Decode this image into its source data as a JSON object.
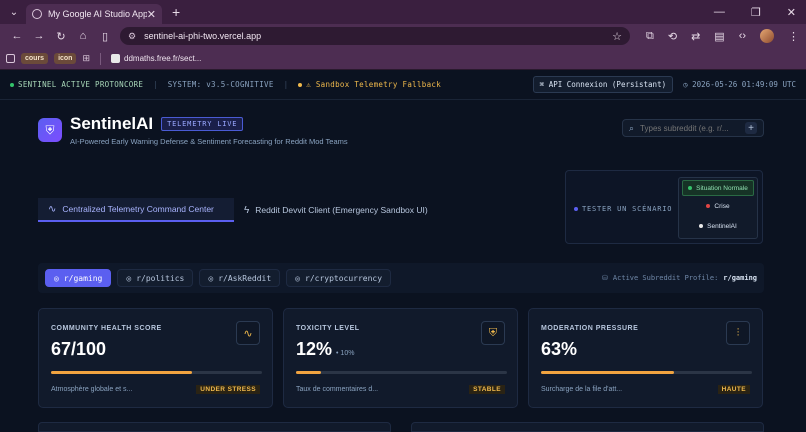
{
  "browser": {
    "tab_title": "My Google AI Studio App",
    "url": "sentinel-ai-phi-two.vercel.app",
    "bookmarks": [
      "cours",
      "icon"
    ],
    "bookmark_link": "ddmaths.free.fr/sect..."
  },
  "statusbar": {
    "core": "SENTINEL ACTIVE PROTONCORE",
    "system": "SYSTEM: v3.5-COGNITIVE",
    "warning": "Sandbox Telemetry Fallback",
    "api": "API Connexion (Persistant)",
    "time": "2026-05-26 01:49:09 UTC"
  },
  "header": {
    "brand": "SentinelAI",
    "badge": "TELEMETRY LIVE",
    "subtitle": "AI-Powered Early Warning Defense & Sentiment Forecasting for Reddit Mod Teams"
  },
  "search": {
    "placeholder": "Types subreddit (e.g. r/..."
  },
  "tabs": [
    {
      "label": "Centralized Telemetry Command Center"
    },
    {
      "label": "Reddit Devvit Client (Emergency Sandbox UI)"
    }
  ],
  "scenario": {
    "label": "TESTER UN SCÉNARIO :",
    "options": [
      {
        "label": "Situation Normale",
        "color": "#34c36a"
      },
      {
        "label": "Crise",
        "color": "#e04545"
      },
      {
        "label": "SentinelAI",
        "color": "#e8e8e8"
      }
    ]
  },
  "subreddits": {
    "items": [
      {
        "label": "r/gaming"
      },
      {
        "label": "r/politics"
      },
      {
        "label": "r/AskReddit"
      },
      {
        "label": "r/cryptocurrency"
      }
    ],
    "profile_label": "Active Subreddit Profile:",
    "profile_value": "r/gaming"
  },
  "cards": [
    {
      "title": "COMMUNITY HEALTH SCORE",
      "value": "67/100",
      "delta": "",
      "progress_pct": 67,
      "note": "Atmosphère globale et s...",
      "tag": "UNDER STRESS",
      "icon": "activity-icon"
    },
    {
      "title": "TOXICITY LEVEL",
      "value": "12%",
      "delta": "• 10%",
      "progress_pct": 12,
      "note": "Taux de commentaires d...",
      "tag": "STABLE",
      "icon": "shield-icon"
    },
    {
      "title": "MODERATION PRESSURE",
      "value": "63%",
      "delta": "",
      "progress_pct": 63,
      "note": "Surcharge de la file d'att...",
      "tag": "HAUTE",
      "icon": "sliders-icon"
    }
  ],
  "colors": {
    "accent": "#5b5ff0",
    "warning": "#f0b94c",
    "bar": "#f0a340"
  }
}
